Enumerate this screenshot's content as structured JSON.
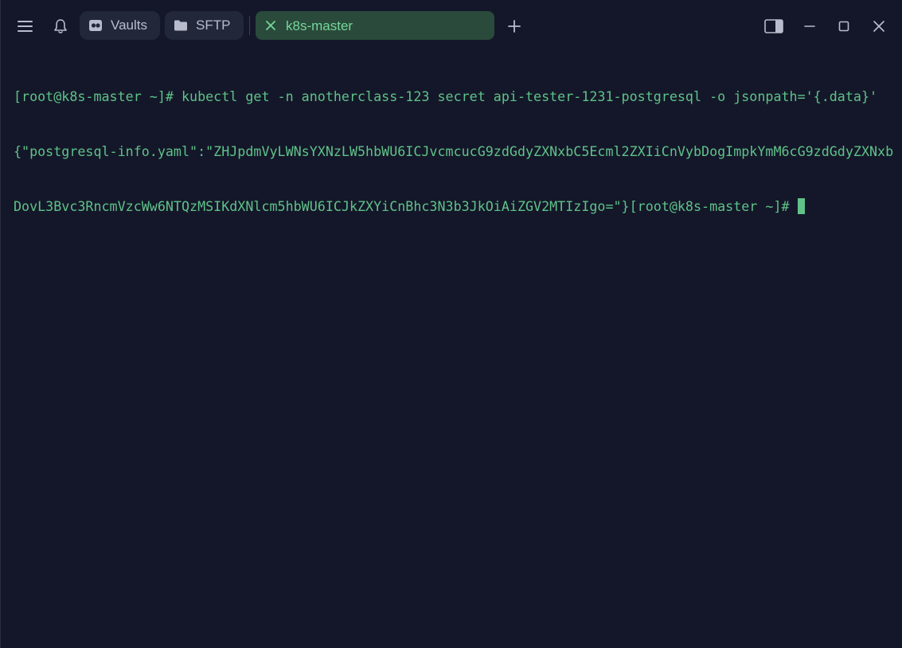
{
  "titlebar": {
    "menu_icon": "hamburger-menu-icon",
    "bell_icon": "bell-icon",
    "vaults": {
      "label": "Vaults",
      "icon": "vault-icon"
    },
    "sftp": {
      "label": "SFTP",
      "icon": "folder-icon"
    },
    "active_tab": {
      "label": "k8s-master",
      "close_icon": "close-icon",
      "color": "#74d79a",
      "bg": "#2a4a3b"
    },
    "add_tab_icon": "plus-icon",
    "window_controls": [
      "sidebar-toggle-icon",
      "minimize-icon",
      "maximize-icon",
      "close-icon"
    ]
  },
  "terminal": {
    "text_color": "#5fc289",
    "background": "#141729",
    "lines": [
      "[root@k8s-master ~]# kubectl get -n anotherclass-123 secret api-tester-1231-postgresql -o jsonpath='{.data}'",
      "{\"postgresql-info.yaml\":\"ZHJpdmVyLWNsYXNzLW5hbWU6ICJvcmcucG9zdGdyZXNxbC5Ecml2ZXIiCnVybDogImpkYmM6cG9zdGdyZXNxb",
      "DovL3Bvc3RncmVzcWw6NTQzMSIKdXNlcm5hbWU6ICJkZXYiCnBhc3N3b3JkOiAiZGV2MTIzIgo=\"}[root@k8s-master ~]#"
    ]
  }
}
